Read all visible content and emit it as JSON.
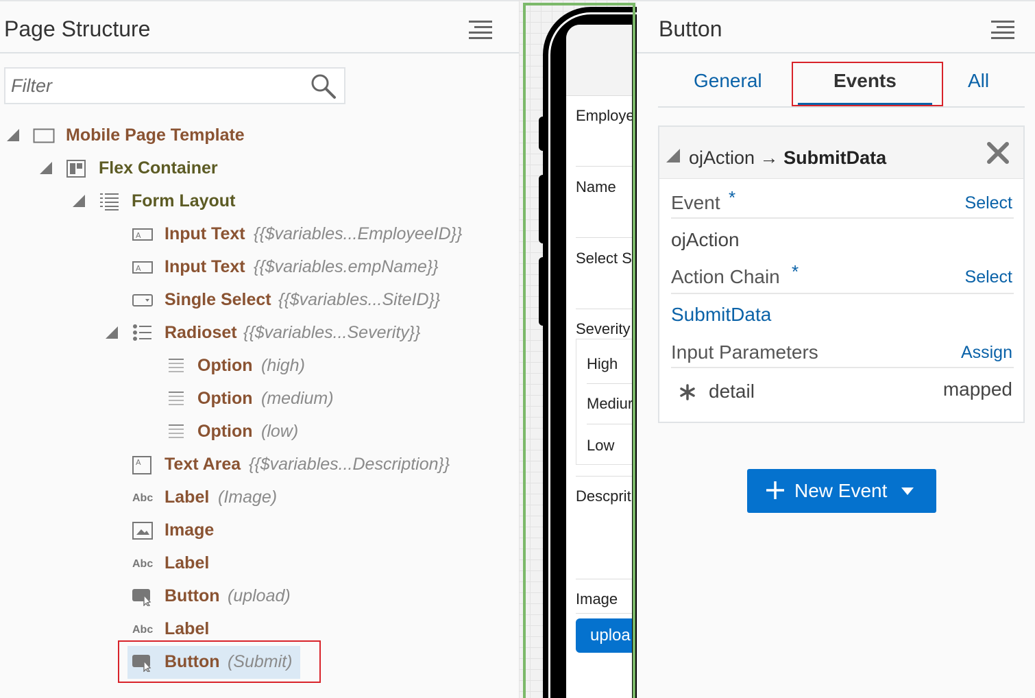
{
  "left_panel": {
    "title": "Page Structure",
    "filter_placeholder": "Filter",
    "tree": [
      {
        "label": "Mobile Page Template",
        "binding": ""
      },
      {
        "label": "Flex Container",
        "binding": ""
      },
      {
        "label": "Form Layout",
        "binding": ""
      },
      {
        "label": "Input Text",
        "binding": "{{$variables...EmployeeID}}"
      },
      {
        "label": "Input Text",
        "binding": "{{$variables.empName}}"
      },
      {
        "label": "Single Select",
        "binding": "{{$variables...SiteID}}"
      },
      {
        "label": "Radioset",
        "binding": "{{$variables...Severity}}"
      },
      {
        "label": "Option",
        "binding": "(high)"
      },
      {
        "label": "Option",
        "binding": "(medium)"
      },
      {
        "label": "Option",
        "binding": "(low)"
      },
      {
        "label": "Text Area",
        "binding": "{{$variables...Description}}"
      },
      {
        "label": "Label",
        "binding": "(Image)"
      },
      {
        "label": "Image",
        "binding": ""
      },
      {
        "label": "Label",
        "binding": ""
      },
      {
        "label": "Button",
        "binding": "(upload)"
      },
      {
        "label": "Label",
        "binding": ""
      },
      {
        "label": "Button",
        "binding": "(Submit)"
      }
    ],
    "abc_icon_text": "Abc"
  },
  "canvas": {
    "fields": [
      "Employe",
      "Name",
      "Select S",
      "Severity",
      "Descprit",
      "Image"
    ],
    "radio_options": [
      "High",
      "Mediur",
      "Low"
    ],
    "button_label": "uploa"
  },
  "right_panel": {
    "title": "Button",
    "tabs": [
      "General",
      "Events",
      "All"
    ],
    "active_tab": "Events",
    "event": {
      "header_prefix": "ojAction →",
      "header_chain": "SubmitData",
      "event_label": "Event",
      "event_action": "Select",
      "event_value": "ojAction",
      "chain_label": "Action Chain",
      "chain_action": "Select",
      "chain_value": "SubmitData",
      "params_label": "Input Parameters",
      "params_action": "Assign",
      "param_name": "detail",
      "param_value": "mapped",
      "required_mark": "*"
    },
    "new_event_label": "New Event"
  },
  "colors": {
    "accent": "#0572ce",
    "link": "#0a62a8",
    "node_label": "#8a5332",
    "node_label_container": "#5c5b24",
    "highlight": "#d8232a",
    "canvas_border": "#7cb96a"
  }
}
